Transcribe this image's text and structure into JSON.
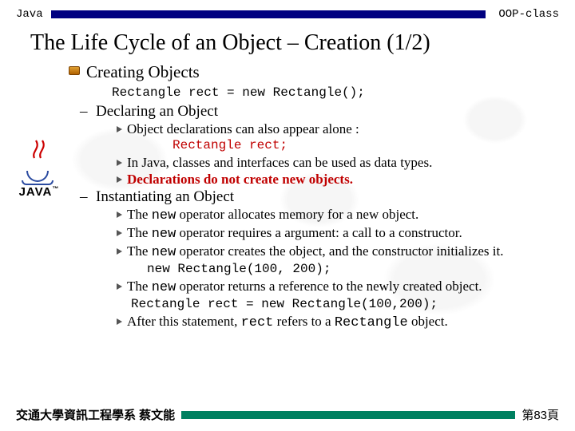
{
  "header": {
    "left": "Java",
    "right": "OOP-class"
  },
  "title": "The Life Cycle of an Object – Creation (1/2)",
  "section": {
    "heading": "Creating Objects",
    "code": "Rectangle rect = new Rectangle();",
    "sub1": {
      "heading": "Declaring an Object",
      "p1": "Object declarations can also appear alone :",
      "code": "Rectangle rect;",
      "p2": "In Java, classes and interfaces can be used as data types.",
      "p3": "Declarations do not create new objects."
    },
    "sub2": {
      "heading": "Instantiating an Object",
      "p1a": "The ",
      "p1b": "new",
      "p1c": " operator allocates memory for a new object.",
      "p2a": "The ",
      "p2b": "new",
      "p2c": " operator requires a argument: a call to a constructor.",
      "p3a": "The ",
      "p3b": "new",
      "p3c": " operator creates the object, and the constructor initializes it.",
      "code1": "new Rectangle(100, 200);",
      "p4a": "The ",
      "p4b": "new",
      "p4c": " operator returns a reference to the newly created object.",
      "code2": "Rectangle rect = new Rectangle(100,200);",
      "p5a": "After this statement, ",
      "p5b": "rect",
      "p5c": " refers to a ",
      "p5d": "Rectangle",
      "p5e": " object."
    }
  },
  "logo": {
    "text": "JAVA",
    "tm": "™"
  },
  "footer": {
    "left": "交通大學資訊工程學系 蔡文能",
    "right": "第83頁"
  }
}
